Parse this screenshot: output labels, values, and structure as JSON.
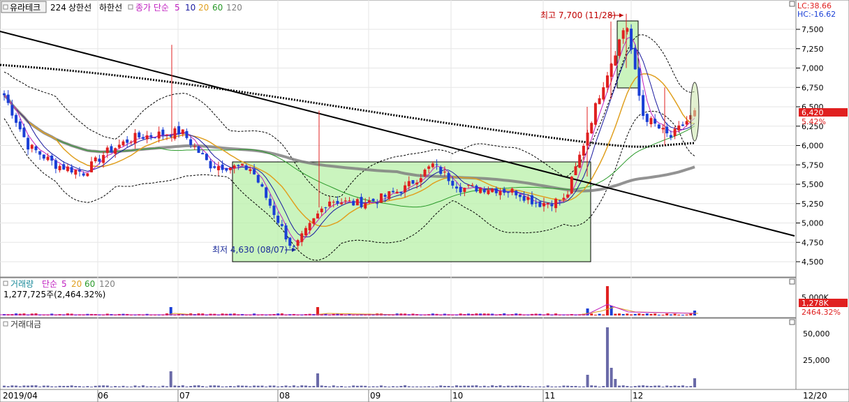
{
  "header": {
    "symbol": "유라테크",
    "code": "224",
    "upper_limit": "상한선",
    "lower_limit": "하한선",
    "ma_label": "종가 단순",
    "ma_periods": [
      "5",
      "10",
      "20",
      "60",
      "120"
    ],
    "lc": "LC:38.66",
    "hc": "HC:-16.62"
  },
  "price_panel": {
    "high_note": "최고 7,700 (11/28)",
    "low_note": "최저 4,630 (08/07)",
    "current_price": "6,420",
    "current_change": "5.42%",
    "y_ticks": [
      "7,500",
      "7,250",
      "7,000",
      "6,750",
      "6,500",
      "6,250",
      "6,000",
      "5,750",
      "5,500",
      "5,250",
      "5,000",
      "4,750",
      "4,500"
    ]
  },
  "volume_panel": {
    "title": "거래량",
    "ma_label": "단순",
    "ma_periods": [
      "5",
      "20",
      "60",
      "120"
    ],
    "summary": "1,277,725주(2,464.32%)",
    "y_tick": "5,000K",
    "current": "1,278K",
    "current_pct": "2464.32%"
  },
  "amount_panel": {
    "title": "거래대금",
    "y_ticks": [
      "50,000",
      "25,000"
    ]
  },
  "x_axis": {
    "labels": [
      "2019/04",
      "06",
      "07",
      "08",
      "09",
      "10",
      "11",
      "12",
      "12/20"
    ]
  },
  "colors": {
    "up": "#e02020",
    "down": "#1a3fd6",
    "ma5": "#c020c0",
    "ma10": "#1a1aa0",
    "ma20": "#e0a020",
    "ma60": "#2a9a2a",
    "ma120": "#808080",
    "box": "#b8f0a8",
    "volume": "#6a6aa8"
  },
  "chart_data": {
    "type": "candlestick",
    "title": "유라테크 224",
    "x_range": [
      "2019/04",
      "2019/12/20"
    ],
    "ylim": [
      4400,
      7850
    ],
    "annotations": [
      {
        "label": "최고 7,700 (11/28)",
        "date": "11/28",
        "value": 7700
      },
      {
        "label": "최저 4,630 (08/07)",
        "date": "08/07",
        "value": 4630
      }
    ],
    "last": {
      "price": 6420,
      "change_pct": 5.42
    },
    "approx_close_path": [
      {
        "date": "2019/04",
        "close": 6650
      },
      {
        "date": "2019/05 early",
        "close": 6000
      },
      {
        "date": "2019/05 mid",
        "close": 5750
      },
      {
        "date": "2019/05 late",
        "close": 5650
      },
      {
        "date": "2019/06 early",
        "close": 5900
      },
      {
        "date": "2019/06 mid",
        "close": 6100
      },
      {
        "date": "2019/06 late",
        "close": 6150
      },
      {
        "date": "2019/07 early",
        "close": 6180
      },
      {
        "date": "2019/07 mid",
        "close": 5750
      },
      {
        "date": "2019/07 late",
        "close": 5700
      },
      {
        "date": "2019/08 early",
        "close": 4650
      },
      {
        "date": "2019/08 mid",
        "close": 5300
      },
      {
        "date": "2019/08 late",
        "close": 5250
      },
      {
        "date": "2019/09 early",
        "close": 5300
      },
      {
        "date": "2019/09 mid",
        "close": 5450
      },
      {
        "date": "2019/09 late",
        "close": 5750
      },
      {
        "date": "2019/10 early",
        "close": 5450
      },
      {
        "date": "2019/10 mid",
        "close": 5450
      },
      {
        "date": "2019/10 late",
        "close": 5400
      },
      {
        "date": "2019/11 early",
        "close": 5250
      },
      {
        "date": "2019/11 mid",
        "close": 5300
      },
      {
        "date": "2019/11 late",
        "close": 6700
      },
      {
        "date": "2019/11/28",
        "close": 7600
      },
      {
        "date": "2019/12 early",
        "close": 6400
      },
      {
        "date": "2019/12 mid",
        "close": 6100
      },
      {
        "date": "2019/12/20",
        "close": 6420
      }
    ],
    "volume_current_k": 1278,
    "amount_ticks": [
      25000,
      50000
    ]
  }
}
